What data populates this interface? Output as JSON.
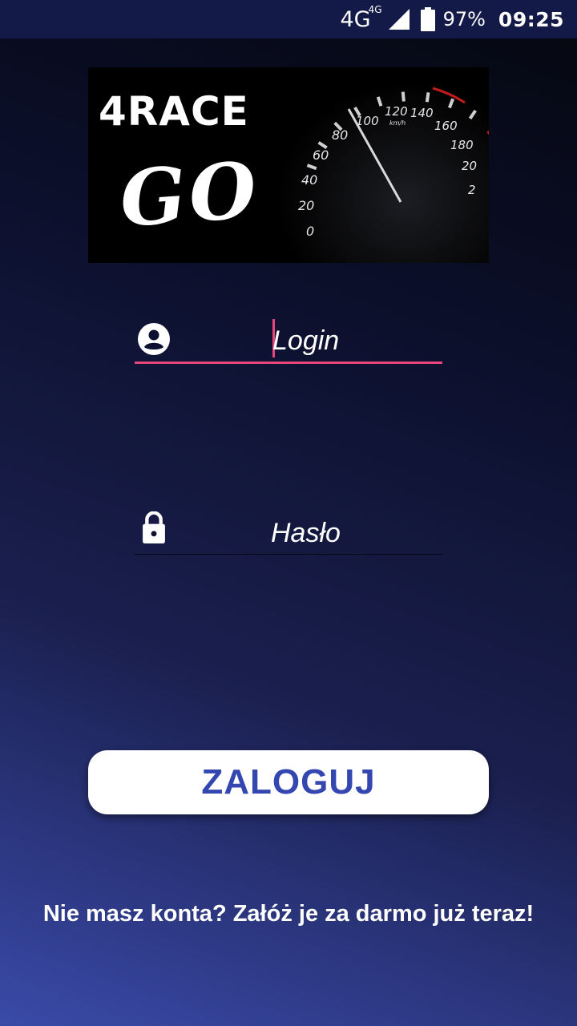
{
  "status_bar": {
    "network": "4G",
    "network_small": "4G",
    "battery": "97%",
    "time": "09:25",
    "icons": [
      "signal-icon",
      "battery-icon"
    ]
  },
  "banner": {
    "title_top": "4RACE",
    "title_bottom": "GO",
    "gauge_labels": [
      "0",
      "20",
      "40",
      "60",
      "80",
      "100",
      "120",
      "140",
      "160",
      "180",
      "20",
      "2"
    ],
    "gauge_unit": "km/h"
  },
  "login": {
    "placeholder": "Login",
    "icon": "account-circle-icon"
  },
  "password": {
    "placeholder": "Hasło",
    "icon": "lock-icon"
  },
  "login_button": "ZALOGUJ",
  "register_link": "Nie masz konta? Załóż je za darmo już teraz!",
  "colors": {
    "accent": "#e8457c",
    "button_text": "#3446b0",
    "status_bar": "#141a47"
  }
}
